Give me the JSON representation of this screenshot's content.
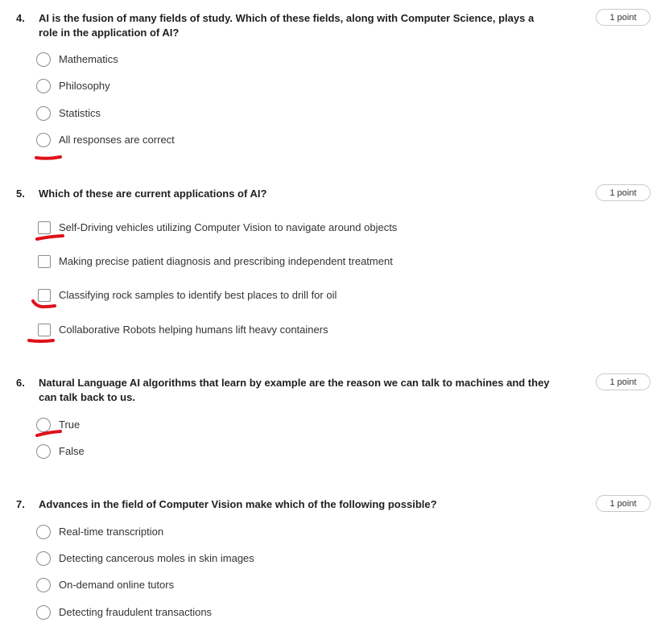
{
  "questions": [
    {
      "number": "4.",
      "text": "AI is the fusion of many fields of study. Which of these fields, along with Computer Science, plays a role in the application of AI?",
      "points": "1 point",
      "type": "radio",
      "options": [
        "Mathematics",
        "Philosophy",
        "Statistics",
        "All responses are correct"
      ]
    },
    {
      "number": "5.",
      "text": "Which of these are current applications of AI?",
      "points": "1 point",
      "type": "checkbox",
      "options": [
        "Self-Driving vehicles utilizing Computer Vision to navigate around objects",
        "Making precise patient diagnosis and prescribing independent treatment",
        "Classifying rock samples to identify best places to drill for oil",
        "Collaborative Robots helping humans lift heavy containers"
      ]
    },
    {
      "number": "6.",
      "text": "Natural Language AI algorithms that learn by example are the reason we can talk to machines and they can talk back to us.",
      "points": "1 point",
      "type": "radio",
      "options": [
        "True",
        "False"
      ]
    },
    {
      "number": "7.",
      "text": "Advances in the field of Computer Vision make which of the following possible?",
      "points": "1 point",
      "type": "radio",
      "options": [
        "Real-time transcription",
        "Detecting cancerous moles in skin images",
        "On-demand online tutors",
        "Detecting fraudulent transactions"
      ]
    }
  ],
  "annotation_color": "#e0101a"
}
